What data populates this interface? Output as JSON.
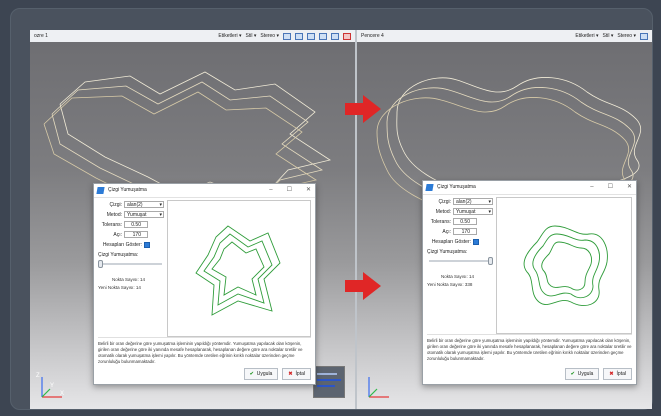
{
  "left_viewport": {
    "title": "ozre 1",
    "menus": [
      "Etiketleri ▾",
      "Stil ▾",
      "Stereo ▾"
    ]
  },
  "right_viewport": {
    "title": "Pencere 4",
    "menus": [
      "Etiketleri ▾",
      "Stil ▾",
      "Stereo ▾"
    ]
  },
  "axes": {
    "z": "Z",
    "x": "X",
    "y": "Y"
  },
  "colors": {
    "arrow": "#e02626",
    "accent": "#2c7bd6",
    "preview_line": "#2f9c3a"
  },
  "dialog_left": {
    "title": "Çizgi Yumuşatma",
    "fields": {
      "cizgi_label": "Çizgi:",
      "cizgi_value": "alan(2)",
      "metod_label": "Metod:",
      "metod_value": "Yumuşat",
      "tolerans_label": "Tolerans:",
      "tolerans_value": "0.50",
      "aci_label": "Açı:",
      "aci_value": "170",
      "hesapla_label": "Hesapları Göster:",
      "slider_label": "Çizgi Yumuşatma:",
      "slider_value": 0.0,
      "nokta_sayisi": "Nokta Sayısı: 14",
      "yeni_nokta_sayisi": "Yeni Nokta Sayısı: 14"
    },
    "description": "Belirli bir oran değerine göre yumuşatma işleminin yapıldığı yöntemdir. Yumuşatma yapılacak olan köşenin, girilen oran değerine göre iki yanında mesafe hesaplanarak, hesaplanan değere göre ara noktalar üretilir ve otomatik olarak yumuşatma işlemi yapılır. Bu yöntemde üretilen eğrinin kırıklı noktalar üzerinden geçme zorunluluğu bulunmamaktadır.",
    "apply_label": "Uygula",
    "cancel_label": "İptal"
  },
  "dialog_right": {
    "title": "Çizgi Yumuşatma",
    "fields": {
      "cizgi_label": "Çizgi:",
      "cizgi_value": "alan(2)",
      "metod_label": "Metod:",
      "metod_value": "Yumuşat",
      "tolerans_label": "Tolerans:",
      "tolerans_value": "0.50",
      "aci_label": "Açı:",
      "aci_value": "170",
      "hesapla_label": "Hesapları Göster:",
      "slider_label": "Çizgi Yumuşatma:",
      "slider_value": 1.0,
      "nokta_sayisi": "Nokta Sayısı: 14",
      "yeni_nokta_sayisi": "Yeni Nokta Sayısı: 338"
    },
    "description": "Belirli bir oran değerine göre yumuşatma işleminin yapıldığı yöntemdir. Yumuşatma yapılacak olan köşenin, girilen oran değerine göre iki yanında mesafe hesaplanarak, hesaplanan değere göre ara noktalar üretilir ve otomatik olarak yumuşatma işlemi yapılır. Bu yöntemde üretilen eğrinin kırıklı noktalar üzerinden geçme zorunluluğu bulunmamaktadır.",
    "apply_label": "Uygula",
    "cancel_label": "İptal"
  }
}
